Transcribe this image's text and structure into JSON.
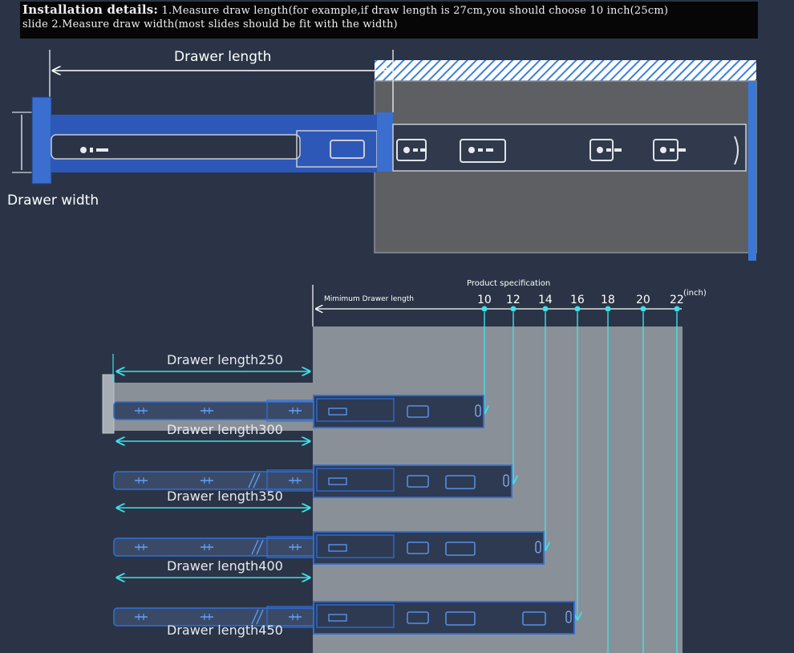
{
  "banner": {
    "line1_title": "Installation details:",
    "line1_text": "1.Measure draw length(for example,if draw length is 27cm,you should choose 10 inch(25cm)",
    "line2_text": "slide   2.Measure draw width(most slides should be fit with the width)"
  },
  "top_diagram": {
    "drawer_length_label": "Drawer length",
    "drawer_width_label": "Drawer width"
  },
  "spec_diagram": {
    "product_spec_label": "Product specification",
    "min_drawer_label": "Mimimum Drawer length",
    "unit_label": "(inch)",
    "sizes": [
      "10",
      "12",
      "14",
      "16",
      "18",
      "20",
      "22"
    ],
    "rows": [
      {
        "label": "Drawer length250"
      },
      {
        "label": "Drawer length300"
      },
      {
        "label": "Drawer length350"
      },
      {
        "label": "Drawer length400"
      },
      {
        "label": "Drawer length450"
      }
    ]
  },
  "colors": {
    "background": "#2a3446",
    "accent_cyan": "#3fe0e8",
    "slide_blue": "#2f6fd8",
    "cabinet_gray": "#8a9098"
  }
}
